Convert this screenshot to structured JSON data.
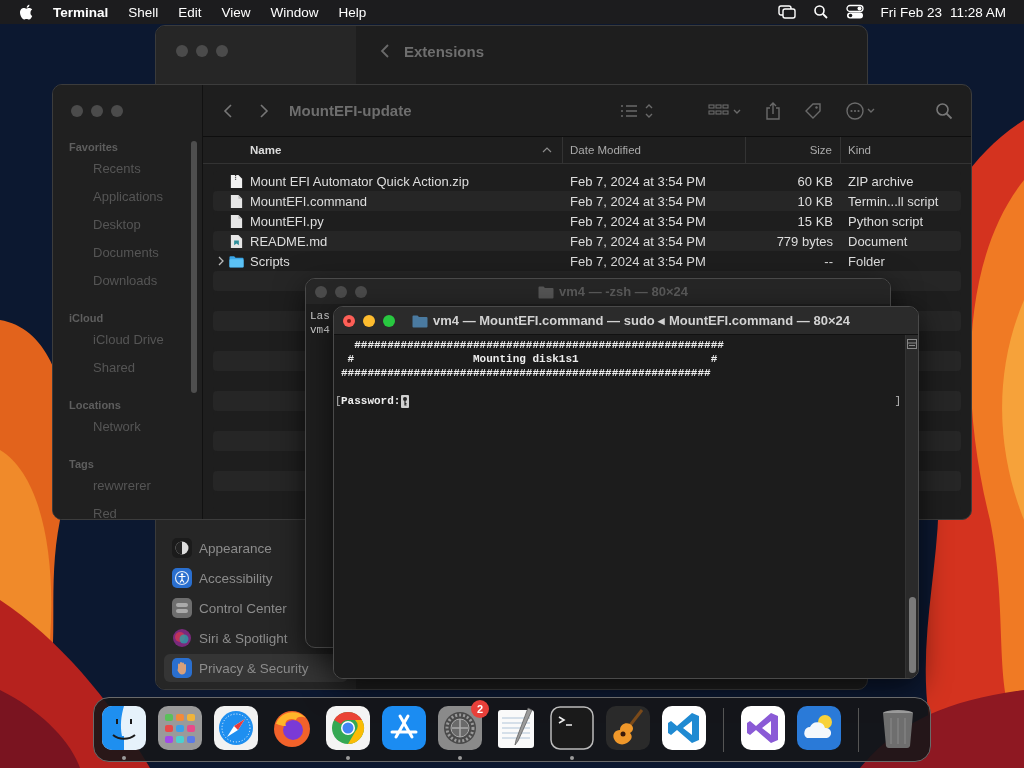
{
  "menu_bar": {
    "app_name": "Terminal",
    "menus": [
      "Shell",
      "Edit",
      "View",
      "Window",
      "Help"
    ],
    "date": "Fri Feb 23",
    "time": "11:28 AM"
  },
  "settings_window": {
    "title": "Extensions",
    "sidebar": [
      {
        "label": "Appearance",
        "kind": "appearance",
        "selected": false
      },
      {
        "label": "Accessibility",
        "kind": "accessibility",
        "selected": false
      },
      {
        "label": "Control Center",
        "kind": "control-center",
        "selected": false
      },
      {
        "label": "Siri & Spotlight",
        "kind": "siri",
        "selected": false
      },
      {
        "label": "Privacy & Security",
        "kind": "privacy",
        "selected": true
      }
    ]
  },
  "finder_window": {
    "title": "MountEFI-update",
    "sidebar": [
      {
        "heading": "Favorites",
        "items": [
          "Recents",
          "Applications",
          "Desktop",
          "Documents",
          "Downloads"
        ]
      },
      {
        "heading": "iCloud",
        "items": [
          "iCloud Drive",
          "Shared"
        ]
      },
      {
        "heading": "Locations",
        "items": [
          "Network"
        ]
      },
      {
        "heading": "Tags",
        "items": [
          "rewwrerer",
          "Red"
        ]
      }
    ],
    "columns": [
      {
        "label": "Name",
        "sorted": true
      },
      {
        "label": "Date Modified",
        "sorted": false
      },
      {
        "label": "Size",
        "sorted": false
      },
      {
        "label": "Kind",
        "sorted": false
      }
    ],
    "rows": [
      {
        "name": "Mount EFI Automator Quick Action.zip",
        "date": "Feb 7, 2024 at 3:54 PM",
        "size": "60 KB",
        "kind_label": "ZIP archive",
        "kind": "zip"
      },
      {
        "name": "MountEFI.command",
        "date": "Feb 7, 2024 at 3:54 PM",
        "size": "10 KB",
        "kind_label": "Termin...ll script",
        "kind": "document"
      },
      {
        "name": "MountEFI.py",
        "date": "Feb 7, 2024 at 3:54 PM",
        "size": "15 KB",
        "kind_label": "Python script",
        "kind": "document"
      },
      {
        "name": "README.md",
        "date": "Feb 7, 2024 at 3:54 PM",
        "size": "779 bytes",
        "kind_label": "Document",
        "kind": "markdown"
      },
      {
        "name": "Scripts",
        "date": "Feb 7, 2024 at 3:54 PM",
        "size": "--",
        "kind_label": "Folder",
        "kind": "folder",
        "expanded": false
      }
    ]
  },
  "terminal_back": {
    "title": "vm4 — -zsh — 80×24",
    "lines": [
      "Las",
      "vm4"
    ]
  },
  "terminal_front": {
    "title": "vm4 — MountEFI.command — sudo ◂ MountEFI.command — 80×24",
    "lines": [
      "  ########################################################",
      " #                  Mounting disk1s1                    #",
      "########################################################"
    ],
    "prompt": "Password:",
    "mark_left": "[",
    "mark_right": "]"
  },
  "dock": {
    "items": [
      {
        "kind": "finder",
        "running": true
      },
      {
        "kind": "launchpad",
        "running": false
      },
      {
        "kind": "safari",
        "running": false
      },
      {
        "kind": "firefox",
        "running": false
      },
      {
        "kind": "chrome",
        "running": true
      },
      {
        "kind": "app-store",
        "running": false
      },
      {
        "kind": "settings",
        "running": true,
        "badge": "2"
      },
      {
        "kind": "textedit",
        "running": false
      },
      {
        "kind": "terminal",
        "running": true
      },
      {
        "kind": "garageband",
        "running": false
      },
      {
        "kind": "vscode",
        "running": false
      },
      {
        "kind": "separator"
      },
      {
        "kind": "visual-studio",
        "running": false
      },
      {
        "kind": "weather",
        "running": false
      },
      {
        "kind": "separator"
      },
      {
        "kind": "trash",
        "running": false
      }
    ]
  }
}
